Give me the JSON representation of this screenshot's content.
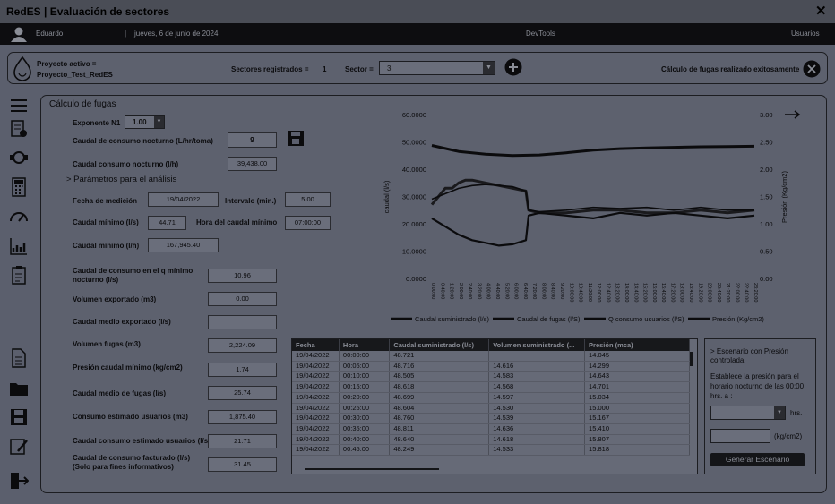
{
  "window": {
    "title": "RedES | Evaluación de sectores",
    "close_glyph": "✕"
  },
  "userbar": {
    "user": "Eduardo",
    "separator": "|",
    "date": "jueves, 6 de junio de 2024",
    "devtools": "DevTools",
    "usuarios": "Usuarios"
  },
  "project": {
    "active_label": "Proyecto activo =",
    "active_value": "Proyecto_Test_RedES",
    "sectors_label": "Sectores registrados =",
    "sectors_value": "1",
    "sector_label": "Sector =",
    "sector_value": "3",
    "status": "Cálculo de fugas realizado exitosamente"
  },
  "panel": {
    "title": "Cálculo de fugas",
    "exponent_label": "Exponente N1",
    "exponent_value": "1.00",
    "caudal_consumo_nocturno_label": "Caudal de consumo nocturno (L/hr/toma)",
    "caudal_consumo_nocturno_value": "9",
    "caudal_consumo_nocturno_lh_label": "Caudal consumo nocturno (l/h)",
    "caudal_consumo_nocturno_lh_value": "39,438.00",
    "analysis_params": "> Parámetros para el análisis",
    "fecha_medicion_label": "Fecha de medición",
    "fecha_medicion_value": "19/04/2022",
    "intervalo_label": "Intervalo (min.)",
    "intervalo_value": "5.00",
    "caudal_minimo_ls_label": "Caudal mínimo (l/s)",
    "caudal_minimo_ls_value": "44.71",
    "hora_caudal_minimo_label": "Hora del caudal mínimo",
    "hora_caudal_minimo_value": "07:00:00",
    "caudal_minimo_lh_label": "Caudal mínimo (l/h)",
    "caudal_minimo_lh_value": "167,945.40",
    "caudal_consumo_q_label": "Caudal de consumo en el q mínimo  nocturno (l/s)",
    "caudal_consumo_q_value": "10.96",
    "volumen_exportado_label": "Volumen exportado (m3)",
    "volumen_exportado_value": "0.00",
    "caudal_medio_exportado_label": "Caudal medio exportado (l/s)",
    "caudal_medio_exportado_value": "",
    "volumen_fugas_label": "Volumen fugas (m3)",
    "volumen_fugas_value": "2,224.09",
    "presion_caudal_minimo_label": "Presión caudal mínimo (kg/cm2)",
    "presion_caudal_minimo_value": "1.74",
    "caudal_medio_fugas_label": "Caudal medio de fugas (l/s)",
    "caudal_medio_fugas_value": "25.74",
    "consumo_estimado_label": "Consumo estimado usuarios (m3)",
    "consumo_estimado_value": "1,875.40",
    "caudal_consumo_estimado_label": "Caudal consumo estimado usuarios (l/s)",
    "caudal_consumo_estimado_value": "21.71",
    "caudal_facturado_label": "Caudal de consumo facturado (l/s) (Solo para fines informativos)",
    "caudal_facturado_value": "31.45"
  },
  "table": {
    "headers": [
      "Fecha",
      "Hora",
      "Caudal suministrado (l/s)",
      "Volumen suministrado (...",
      "Presión (mca)"
    ],
    "rows": [
      [
        "19/04/2022",
        "00:00:00",
        "48.721",
        "",
        "14.045"
      ],
      [
        "19/04/2022",
        "00:05:00",
        "48.716",
        "14.616",
        "14.299"
      ],
      [
        "19/04/2022",
        "00:10:00",
        "48.505",
        "14.583",
        "14.643"
      ],
      [
        "19/04/2022",
        "00:15:00",
        "48.618",
        "14.568",
        "14.701"
      ],
      [
        "19/04/2022",
        "00:20:00",
        "48.699",
        "14.597",
        "15.034"
      ],
      [
        "19/04/2022",
        "00:25:00",
        "48.604",
        "14.530",
        "15.000"
      ],
      [
        "19/04/2022",
        "00:30:00",
        "48.760",
        "14.539",
        "15.167"
      ],
      [
        "19/04/2022",
        "00:35:00",
        "48.811",
        "14.636",
        "15.410"
      ],
      [
        "19/04/2022",
        "00:40:00",
        "48.640",
        "14.618",
        "15.807"
      ],
      [
        "19/04/2022",
        "00:45:00",
        "48.249",
        "14.533",
        "15.818"
      ]
    ]
  },
  "scenario": {
    "title": "> Escenario con Presión controlada.",
    "instruction": "Establece la presión para el horario nocturno de las 00:00 hrs. a :",
    "hrs": "hrs.",
    "kg": "(kg/cm2)",
    "button": "Generar  Escenario"
  },
  "chart_data": {
    "type": "line",
    "title": "",
    "xlabel": "",
    "ylabel": "caudal (l/s)",
    "y2label": "Presión (Kg/cm2)",
    "ylim": [
      0,
      60
    ],
    "y2lim": [
      0,
      3
    ],
    "yticks": [
      "0.0000",
      "10.0000",
      "20.0000",
      "30.0000",
      "40.0000",
      "50.0000",
      "60.0000"
    ],
    "y2ticks": [
      "0.00",
      "0.50",
      "1.00",
      "1.50",
      "2.00",
      "2.50",
      "3.00"
    ],
    "xticks": [
      "0:00:00",
      "0:40:00",
      "1:20:00",
      "2:00:00",
      "2:40:00",
      "3:20:00",
      "4:00:00",
      "4:40:00",
      "5:20:00",
      "6:00:00",
      "6:40:00",
      "7:20:00",
      "8:00:00",
      "8:40:00",
      "9:20:00",
      "10:00:00",
      "10:40:00",
      "11:20:00",
      "12:00:00",
      "12:40:00",
      "13:20:00",
      "14:00:00",
      "14:40:00",
      "15:20:00",
      "16:00:00",
      "16:40:00",
      "17:20:00",
      "18:00:00",
      "18:40:00",
      "19:20:00",
      "20:00:00",
      "20:40:00",
      "21:20:00",
      "22:00:00",
      "22:40:00",
      "23:20:00"
    ],
    "legend_position": "bottom",
    "series": [
      {
        "name": "Caudal suministrado (l/s)",
        "axis": "left",
        "x": [
          0,
          2,
          4,
          6,
          8,
          10,
          12,
          14,
          16,
          18,
          20,
          22,
          24
        ],
        "values": [
          48.7,
          46.5,
          45.5,
          45.0,
          45.2,
          46.0,
          47.0,
          47.5,
          47.8,
          48.0,
          48.2,
          48.3,
          48.4
        ]
      },
      {
        "name": "Caudal de fugas (l/S)",
        "axis": "left",
        "x": [
          0,
          0.5,
          1,
          1.5,
          2,
          2.5,
          3,
          4,
          5,
          6,
          7,
          7.2,
          8,
          10,
          12,
          14,
          16,
          18,
          20,
          22,
          24
        ],
        "values": [
          27,
          30,
          33,
          33,
          35,
          36,
          36,
          35,
          34,
          33,
          32,
          25,
          24,
          24,
          25,
          25,
          24,
          24,
          25,
          24,
          25
        ]
      },
      {
        "name": "Q consumo usuarios (l/S)",
        "axis": "left",
        "x": [
          0,
          1,
          2,
          3,
          4,
          5,
          6,
          7,
          7.2,
          8,
          10,
          12,
          14,
          16,
          18,
          20,
          22,
          24
        ],
        "values": [
          22,
          19,
          16,
          14,
          13,
          12,
          12.5,
          14,
          23,
          24,
          23,
          22,
          24,
          23,
          24,
          23,
          22,
          23
        ]
      },
      {
        "name": "Presión (Kg/cm2)",
        "axis": "right",
        "x": [
          0,
          1,
          2,
          3,
          4,
          5,
          6,
          7,
          7.2,
          8,
          10,
          12,
          14,
          16,
          18,
          20,
          22,
          24
        ],
        "values": [
          1.45,
          1.55,
          1.65,
          1.7,
          1.72,
          1.7,
          1.68,
          1.6,
          1.25,
          1.22,
          1.25,
          1.3,
          1.28,
          1.3,
          1.25,
          1.3,
          1.25,
          1.25
        ]
      }
    ]
  }
}
